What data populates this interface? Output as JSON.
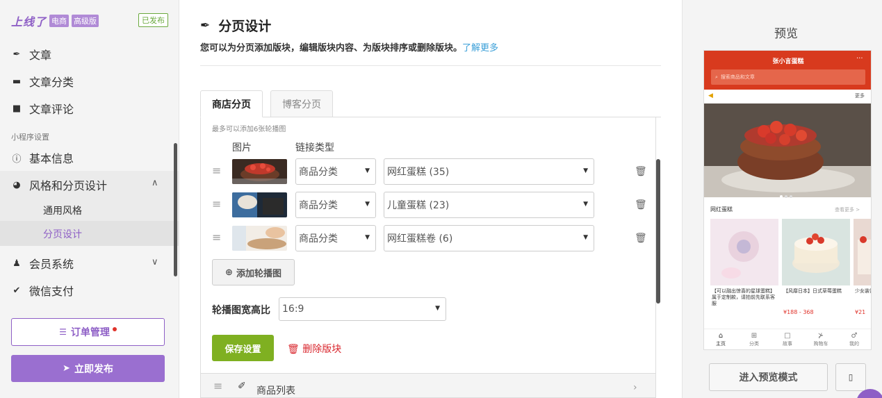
{
  "brand": {
    "logo": "上线了",
    "tag_ecommerce": "电商",
    "tag_plan": "高级版",
    "status": "已发布"
  },
  "sidebar": {
    "items": [
      {
        "label": "文章",
        "icon": "feather-icon"
      },
      {
        "label": "文章分类",
        "icon": "folder-icon"
      },
      {
        "label": "文章评论",
        "icon": "comments-icon"
      }
    ],
    "section_label": "小程序设置",
    "settings": [
      {
        "label": "基本信息",
        "icon": "info-circle-icon"
      },
      {
        "label": "风格和分页设计",
        "icon": "palette-icon",
        "expanded": true
      },
      {
        "label": "会员系统",
        "icon": "users-icon"
      },
      {
        "label": "微信支付",
        "icon": "check-badge-icon"
      }
    ],
    "sub_items": [
      {
        "label": "通用风格"
      },
      {
        "label": "分页设计",
        "active": true
      }
    ],
    "order_button": "订单管理",
    "publish_button": "立即发布"
  },
  "main": {
    "title": "分页设计",
    "desc": "您可以为分页添加版块，编辑版块内容、为版块排序或删除版块。",
    "learn_more": "了解更多",
    "tabs": [
      {
        "label": "商店分页",
        "active": true
      },
      {
        "label": "博客分页",
        "active": false
      }
    ],
    "hint": "最多可以添加6张轮播图",
    "col_image": "图片",
    "col_link_type": "链接类型",
    "rows": [
      {
        "link_type": "商品分类",
        "target": "网红蛋糕 (35)"
      },
      {
        "link_type": "商品分类",
        "target": "儿童蛋糕 (23)"
      },
      {
        "link_type": "商品分类",
        "target": "网红蛋糕卷 (6)"
      }
    ],
    "add_button": "添加轮播图",
    "ratio_label": "轮播图宽高比",
    "ratio_value": "16:9",
    "save_button": "保存设置",
    "delete_link": "删除版块",
    "next_block": "商品列表"
  },
  "preview": {
    "title": "预览",
    "shop_name": "张小言蛋糕",
    "more_dots": "···",
    "search_placeholder": "搜索商品和文章",
    "notice_more": "更多",
    "section_title": "网红蛋糕",
    "section_more": "查看更多 >",
    "products": [
      {
        "name": "【可以融出惊喜的星球蛋糕】属于定制款，请拍前先联系客服",
        "price": ""
      },
      {
        "name": "【风靡日本】日式草莓蛋糕",
        "price": "¥188 - 368"
      },
      {
        "name": "少女装饰",
        "price": "¥21"
      }
    ],
    "tabbar": [
      {
        "label": "主页",
        "icon": "home-icon",
        "active": true
      },
      {
        "label": "分类",
        "icon": "grid-icon"
      },
      {
        "label": "故事",
        "icon": "book-icon"
      },
      {
        "label": "购物车",
        "icon": "cart-icon"
      },
      {
        "label": "我的",
        "icon": "user-icon"
      }
    ],
    "preview_mode_button": "进入预览模式"
  },
  "colors": {
    "accent": "#8e5fc6",
    "save": "#7fb021",
    "danger": "#d9272e",
    "link": "#3a9fd8",
    "phone_header": "#d83a1e"
  }
}
